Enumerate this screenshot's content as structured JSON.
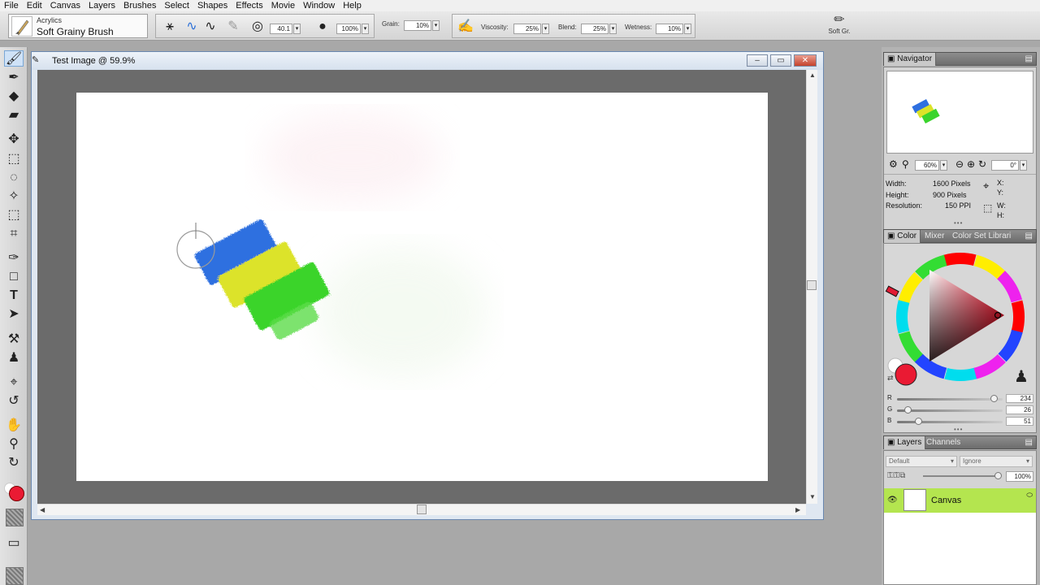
{
  "menu": [
    "File",
    "Edit",
    "Canvas",
    "Layers",
    "Brushes",
    "Select",
    "Shapes",
    "Effects",
    "Movie",
    "Window",
    "Help"
  ],
  "property_bar": {
    "brush_category": "Acrylics",
    "brush_variant": "Soft Grainy Brush",
    "size_value": "40.1",
    "opacity_value": "100%",
    "grain_label": "Grain:",
    "grain_value": "10%",
    "viscosity_label": "Viscosity:",
    "viscosity_value": "25%",
    "blend_label": "Blend:",
    "blend_value": "25%",
    "wetness_label": "Wetness:",
    "wetness_value": "10%",
    "recent_brush_label": "Soft Gr."
  },
  "document": {
    "title": "Test Image @ 59.9%"
  },
  "navigator": {
    "tab": "Navigator",
    "zoom": "60%",
    "rotation": "0°",
    "width_label": "Width:",
    "width_value": "1600 Pixels",
    "height_label": "Height:",
    "height_value": "900 Pixels",
    "resolution_label": "Resolution:",
    "resolution_value": "150 PPI",
    "x_label": "X:",
    "y_label": "Y:",
    "w_label": "W:",
    "h_label": "H:"
  },
  "color_panel": {
    "tabs": [
      "Color",
      "Mixer",
      "Color Set Librari"
    ],
    "r_label": "R",
    "g_label": "G",
    "b_label": "B",
    "r_value": "234",
    "g_value": "26",
    "b_value": "51",
    "r_level": 0.918,
    "g_level": 0.102,
    "b_level": 0.2,
    "main_color": "#ea1a33"
  },
  "layers_panel": {
    "tabs": [
      "Layers",
      "Channels"
    ],
    "composite_method": "Default",
    "composite_depth": "Ignore",
    "opacity_value": "100%",
    "layers": [
      {
        "name": "Canvas",
        "selected_color": "#b4e54f"
      }
    ]
  }
}
